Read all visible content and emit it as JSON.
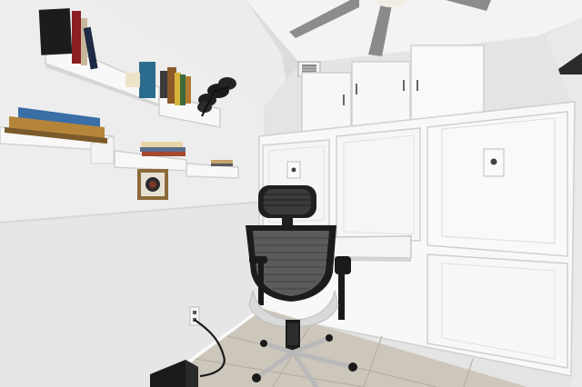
{
  "colors": {
    "wall": "#efefef",
    "wall_shadow": "#d9d9d9",
    "ceiling": "#f6f6f6",
    "cabinet": "#f8f8f8",
    "cabinet_edge": "#cfcfcf",
    "floor": "#cfc8bd",
    "floor_joint": "#b9b1a5",
    "chair_frame": "#1e1e1e",
    "chair_mesh": "#3a3a3a",
    "chair_base": "#9a9a9a"
  },
  "objects": [
    "ceiling-fan",
    "air-vent",
    "floating-wall-shelves",
    "books",
    "plant",
    "framed-picture",
    "murphy-bed-cabinet",
    "upper-cabinets",
    "fold-down-desk",
    "mesh-office-chair",
    "tile-floor",
    "power-outlet",
    "power-cord",
    "subwoofer"
  ]
}
